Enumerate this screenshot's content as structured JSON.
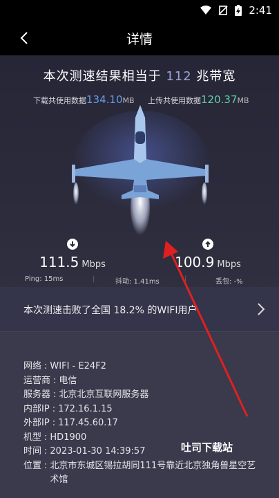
{
  "status": {
    "time": "2:41"
  },
  "header": {
    "title": "详情"
  },
  "summary": {
    "prefix": "本次测速结果相当于",
    "value": "112",
    "suffix": "兆带宽"
  },
  "download_data": {
    "label": "下载共使用数据",
    "value": "134.10",
    "unit": "MB"
  },
  "upload_data": {
    "label": "上传共使用数据",
    "value": "120.37",
    "unit": "MB"
  },
  "download_speed": {
    "value": "111.5",
    "unit": "Mbps"
  },
  "upload_speed": {
    "value": "100.9",
    "unit": "Mbps"
  },
  "stats": {
    "ping": "Ping: 15ms",
    "jitter": "抖动: 1.41ms",
    "loss": "丢包: -%"
  },
  "beat": {
    "text": "本次测速击败了全国 18.2% 的WIFI用户"
  },
  "details": [
    {
      "label": "网络",
      "value": "WIFI - E24F2"
    },
    {
      "label": "运营商",
      "value": "电信"
    },
    {
      "label": "服务器",
      "value": "北京北京互联网服务器"
    },
    {
      "label": "内部IP",
      "value": "172.16.1.15"
    },
    {
      "label": "外部IP",
      "value": "117.45.60.17"
    },
    {
      "label": "机型",
      "value": "HD1900"
    },
    {
      "label": "时间",
      "value": "2023-01-30 14:39:57"
    },
    {
      "label": "位置",
      "value": "北京市东城区锡拉胡同111号靠近北京独角兽星空艺术馆"
    }
  ],
  "watermark": "吐司下载站",
  "colors": {
    "download": "#6b9be8",
    "upload": "#5fd0a6",
    "accent": "#9aa6d8",
    "arrow": "#e02020"
  }
}
